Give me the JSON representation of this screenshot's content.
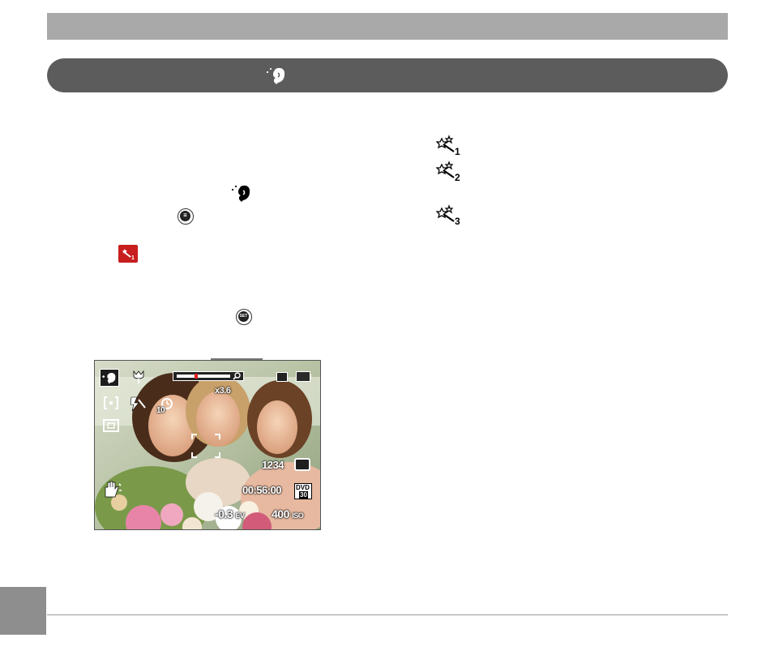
{
  "preview": {
    "zoom": "x3.6",
    "self_timer": "10",
    "shots_remaining": "1234",
    "rec_time": "00:56:00",
    "video_quality": "DVD",
    "video_fps": "30",
    "ev": "-0.3",
    "ev_unit": "EV",
    "iso": "400",
    "iso_unit": "ISO",
    "zoom_level": 0.35
  },
  "icons": {
    "section": "face-beauty-icon",
    "beauty_levels": [
      "effect-1-icon",
      "effect-2-icon",
      "effect-3-icon"
    ],
    "menu_button": "menu-button-icon",
    "set_button": "set-button-icon"
  },
  "button_labels": {
    "menu": "☰",
    "set": "SET"
  },
  "beauty_level_numbers": [
    "1",
    "2",
    "3"
  ],
  "colors": {
    "topbar": "#a9a9a9",
    "section_bar": "#5c5c5c",
    "highlight": "#c81e1e"
  }
}
